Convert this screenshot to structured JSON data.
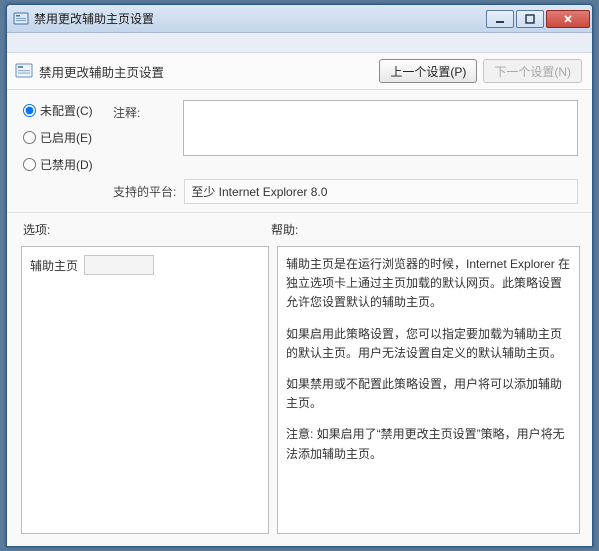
{
  "window": {
    "title": "禁用更改辅助主页设置"
  },
  "header": {
    "policy_title": "禁用更改辅助主页设置",
    "prev_btn": "上一个设置(P)",
    "next_btn": "下一个设置(N)"
  },
  "radios": {
    "not_configured": "未配置(C)",
    "enabled": "已启用(E)",
    "disabled": "已禁用(D)"
  },
  "labels": {
    "comment": "注释:",
    "platform": "支持的平台:",
    "options": "选项:",
    "help": "帮助:"
  },
  "values": {
    "comment": "",
    "platform": "至少 Internet Explorer 8.0"
  },
  "options": {
    "secondary_home_label": "辅助主页",
    "secondary_home_value": ""
  },
  "help": {
    "p1": "辅助主页是在运行浏览器的时候，Internet Explorer 在独立选项卡上通过主页加载的默认网页。此策略设置允许您设置默认的辅助主页。",
    "p2": "如果启用此策略设置，您可以指定要加载为辅助主页的默认主页。用户无法设置自定义的默认辅助主页。",
    "p3": "如果禁用或不配置此策略设置，用户将可以添加辅助主页。",
    "p4": "注意: 如果启用了“禁用更改主页设置”策略，用户将无法添加辅助主页。"
  }
}
